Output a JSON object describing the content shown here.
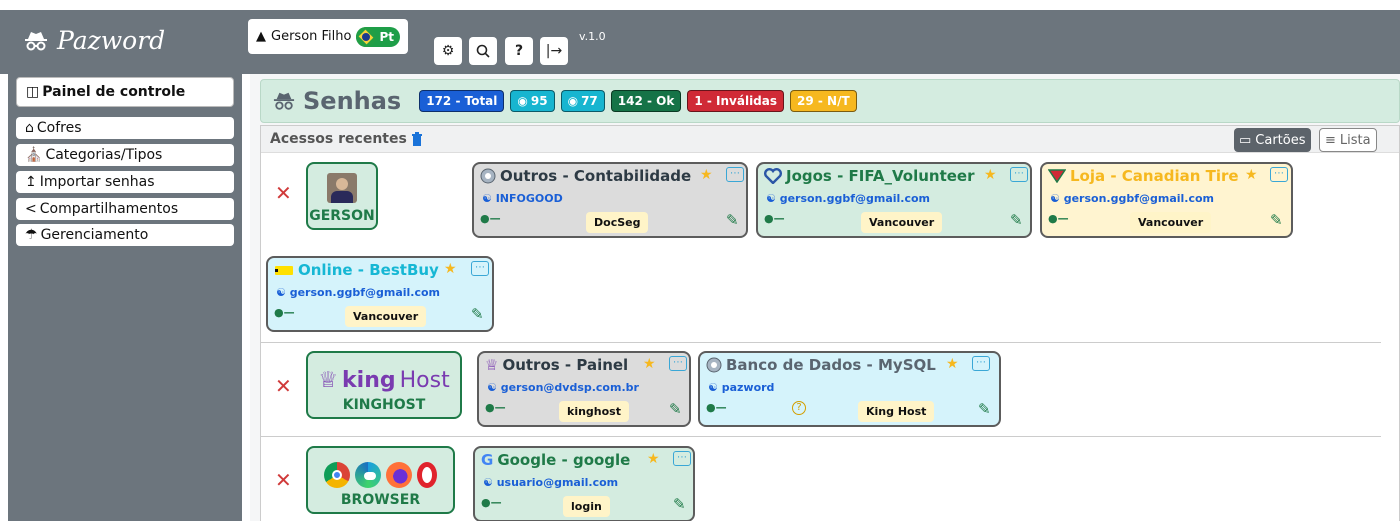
{
  "app": {
    "name": "Pazword",
    "version": "v.1.0"
  },
  "user": {
    "name": "Gerson Filho",
    "lang": "Pt"
  },
  "sidebar": {
    "items": [
      {
        "label": "Painel de controle"
      },
      {
        "label": "Cofres"
      },
      {
        "label": "Categorias/Tipos"
      },
      {
        "label": "Importar senhas"
      },
      {
        "label": "Compartilhamentos"
      },
      {
        "label": "Gerenciamento"
      }
    ]
  },
  "header": {
    "title": "Senhas",
    "badges": {
      "total": "172 - Total",
      "v1": "95",
      "v2": "77",
      "ok": "142 - Ok",
      "invalid": "1 - Inválidas",
      "nt": "29 - N/T"
    }
  },
  "recent": {
    "title": "Acessos recentes",
    "view_cards": "Cartões",
    "view_list": "Lista"
  },
  "groups": [
    {
      "source": "GERSON",
      "cards": [
        {
          "title": "Outros - Contabilidade",
          "user": "INFOGOOD",
          "tag": "DocSeg"
        },
        {
          "title": "Jogos - FIFA_Volunteer",
          "user": "gerson.ggbf@gmail.com",
          "tag": "Vancouver"
        },
        {
          "title": "Loja - Canadian Tire",
          "user": "gerson.ggbf@gmail.com",
          "tag": "Vancouver"
        },
        {
          "title": "Online - BestBuy",
          "user": "gerson.ggbf@gmail.com",
          "tag": "Vancouver"
        }
      ]
    },
    {
      "source": "KINGHOST",
      "logo": {
        "a": "king",
        "b": "Host"
      },
      "cards": [
        {
          "title": "Outros - Painel",
          "user": "gerson@dvdsp.com.br",
          "tag": "kinghost"
        },
        {
          "title": "Banco de Dados - MySQL",
          "user": "pazword",
          "tag": "King Host"
        }
      ]
    },
    {
      "source": "BROWSER",
      "cards": [
        {
          "title": "Google - google",
          "user": "usuario@gmail.com",
          "tag": "login"
        }
      ]
    }
  ],
  "colors": {
    "sidebar": "#6c757d",
    "accent_green": "#1f7a48",
    "header_bg": "#d4ece0"
  }
}
